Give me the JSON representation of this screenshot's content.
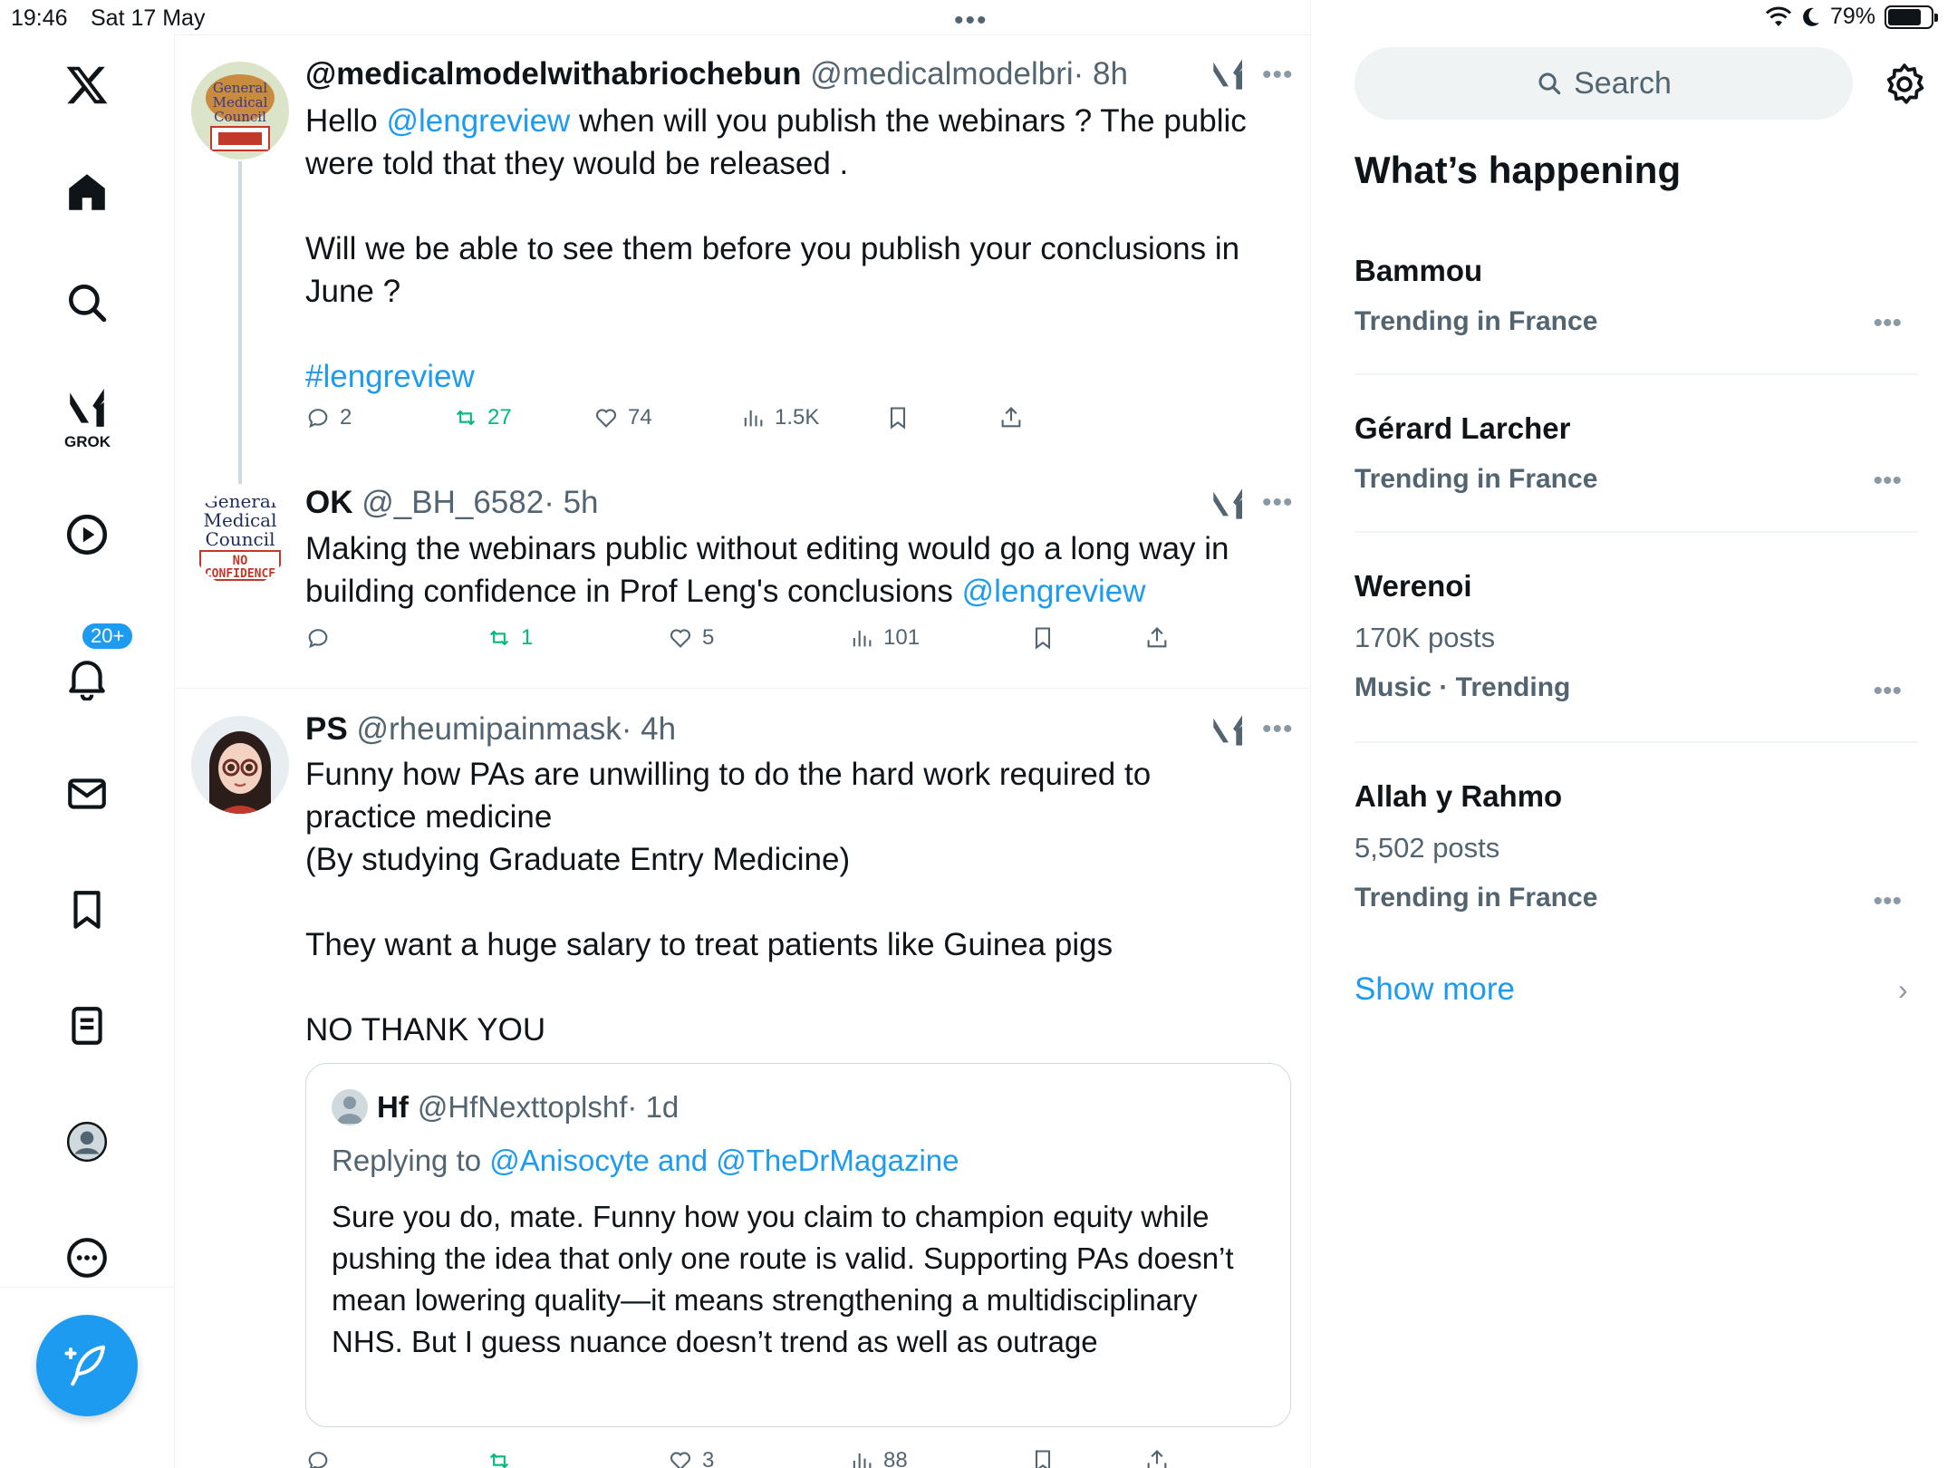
{
  "status_bar": {
    "time": "19:46",
    "date": "Sat 17 May",
    "battery": "79%",
    "battery_level": 0.79
  },
  "nav": {
    "grok_label": "GROK",
    "notifications_badge": "20+"
  },
  "posts": [
    {
      "name": "@medicalmodelwithabriochebun",
      "handle": "@medicalmodelbri",
      "time": "· 8h",
      "text_prefix": "Hello ",
      "mention": "@lengreview",
      "text_mid": " when will you publish the webinars ? The public were told that they would be released .\n\nWill we be able to see them before you publish your conclusions in June ?\n\n",
      "hashtag": "#lengreview",
      "replies": "2",
      "reposts": "27",
      "likes": "74",
      "views": "1.5K"
    },
    {
      "name": "OK",
      "handle": "@_BH_6582",
      "time": "· 5h",
      "text": "Making the webinars public without editing would go a long way in building confidence in Prof Leng's conclusions ",
      "mention": "@lengreview",
      "reposts": "1",
      "likes": "5",
      "views": "101",
      "avatar_text": [
        "General",
        "Medical",
        "Council",
        "NO",
        "CONFIDENCE"
      ]
    },
    {
      "name": "PS",
      "handle": "@rheumipainmask",
      "time": "· 4h",
      "text": "Funny how PAs are unwilling to do the hard work required to practice medicine\n(By studying Graduate Entry Medicine)\n\nThey want a huge salary to treat patients like Guinea pigs\n\nNO THANK YOU",
      "likes": "3",
      "views": "88",
      "quote": {
        "name": "Hf",
        "handle": "@HfNexttoplshf",
        "time": "· 1d",
        "replying_prefix": "Replying to ",
        "replying_to": "@Anisocyte and @TheDrMagazine",
        "text": "Sure you do, mate. Funny how you claim to champion equity while pushing the idea that only one route is valid. Supporting PAs doesn’t mean lowering quality—it means strengthening a multidisciplinary NHS. But I guess nuance doesn’t trend as well as outrage"
      }
    }
  ],
  "sidebar": {
    "search_placeholder": "Search",
    "title": "What’s happening",
    "trends": [
      {
        "name": "Bammou",
        "meta": "Trending in France"
      },
      {
        "name": "Gérard Larcher",
        "meta": "Trending in France"
      },
      {
        "name": "Werenoi",
        "posts": "170K posts",
        "meta": "Music · Trending"
      },
      {
        "name": "Allah y Rahmo",
        "posts": "5,502 posts",
        "meta": "Trending in France"
      }
    ],
    "show_more": "Show more"
  },
  "colors": {
    "accent": "#1d9bf0",
    "repost_green": "#00ba7c",
    "secondary_text": "#536471"
  }
}
